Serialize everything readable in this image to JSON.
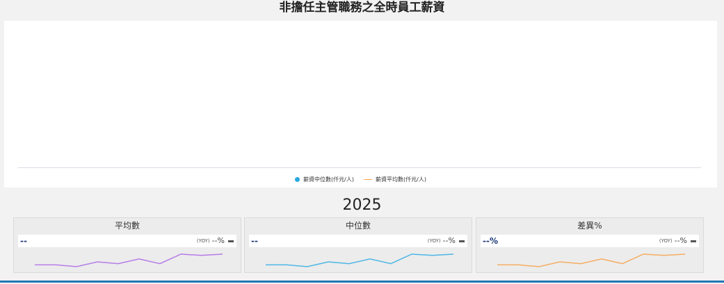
{
  "page": {
    "title": "非擔任主管職務之全時員工薪資"
  },
  "legend": {
    "items": [
      {
        "label": "薪資中位數(仟元/人)",
        "color": "#29a8e0",
        "marker": "dot"
      },
      {
        "label": "薪資平均數(仟元/人)",
        "color": "#f5a35c",
        "marker": "line"
      }
    ]
  },
  "year": "2025",
  "cards": [
    {
      "title": "平均數",
      "value": "--",
      "yoy_label": "(YOY)",
      "yoy_value": "--%",
      "spark_color": "#b57be8"
    },
    {
      "title": "中位數",
      "value": "--",
      "yoy_label": "(YOY)",
      "yoy_value": "--%",
      "spark_color": "#4cb6e6"
    },
    {
      "title": "差異%",
      "value": "--%",
      "yoy_label": "(YOY)",
      "yoy_value": "--%",
      "spark_color": "#f5ad62"
    }
  ],
  "sparkline_data": [
    0.55,
    0.55,
    0.4,
    0.8,
    0.65,
    1.05,
    0.65,
    1.45,
    1.35,
    1.45
  ]
}
